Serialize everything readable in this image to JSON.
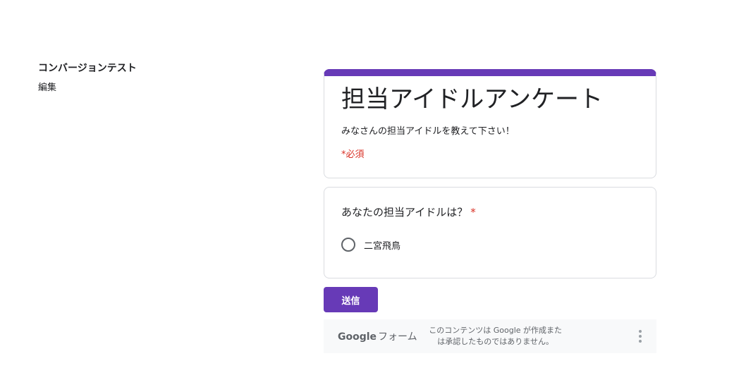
{
  "sidebar": {
    "title": "コンバージョンテスト",
    "edit_label": "編集"
  },
  "form": {
    "accent_color": "#673ab7",
    "title": "担当アイドルアンケート",
    "description": "みなさんの担当アイドルを教えて下さい！",
    "required_note": "*必須"
  },
  "question": {
    "title": "あなたの担当アイドルは？",
    "required_mark": "*",
    "options": [
      {
        "label": "二宮飛鳥",
        "selected": false
      }
    ]
  },
  "submit": {
    "label": "送信"
  },
  "footer": {
    "brand_google": "Google",
    "brand_forms": "フォーム",
    "disclaimer_line1": "このコンテンツは Google が作成また",
    "disclaimer_line2": "は承認したものではありません。",
    "menu_icon": "more-vert-icon"
  }
}
